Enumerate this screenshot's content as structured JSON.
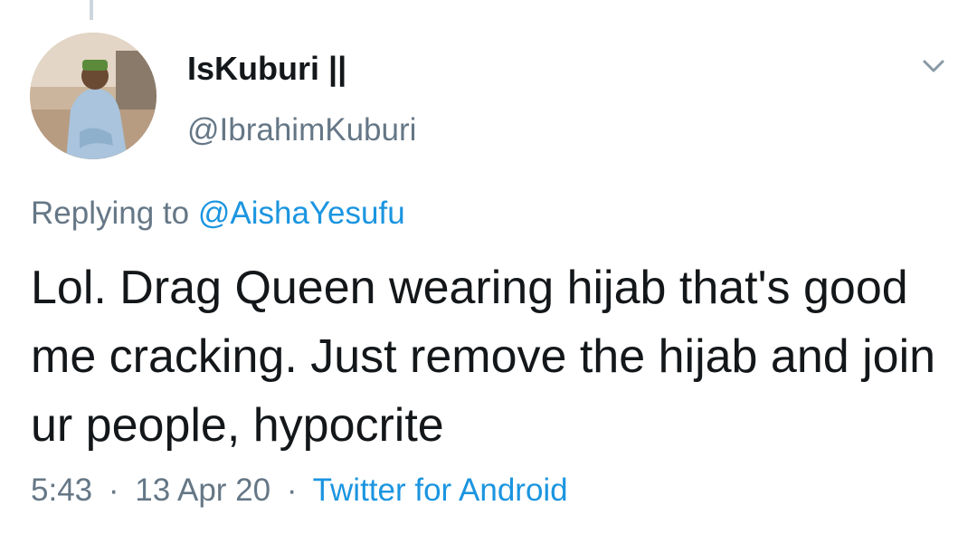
{
  "tweet": {
    "author": {
      "display_name": "IsKuburi ||",
      "handle": "@IbrahimKuburi",
      "avatar": "avatar-photo"
    },
    "replying_to": {
      "prefix": "Replying to",
      "mention": "@AishaYesufu"
    },
    "text": "Lol. Drag Queen wearing hijab that's good me cracking. Just remove the hijab and join ur people, hypocrite",
    "time": "5:43",
    "date": "13 Apr 20",
    "source": "Twitter for Android",
    "separator": "·",
    "menu_icon": "chevron-down-icon"
  },
  "colors": {
    "text": "#14171a",
    "secondary": "#657786",
    "link": "#1b95e0"
  }
}
